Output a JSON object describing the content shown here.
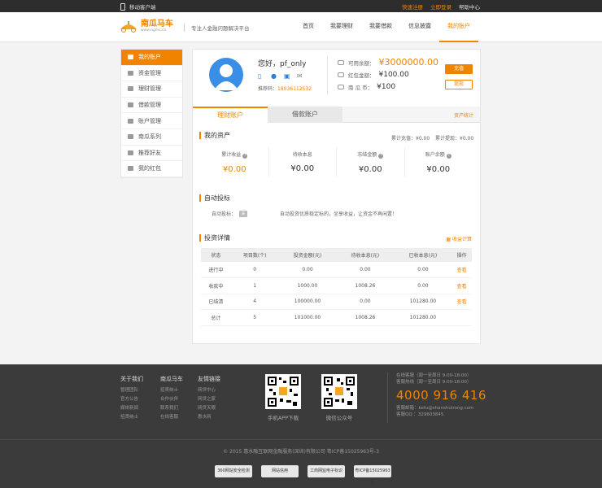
{
  "topbar": {
    "mobile_label": "移动客户端",
    "register": "快速注册",
    "login": "立即登录",
    "help": "帮助中心"
  },
  "header": {
    "logo_text": "南瓜马车",
    "logo_sub": "www.ngmc.cn",
    "slogan": "专注人金融问题解决平台",
    "nav": [
      "首页",
      "我要理财",
      "我要借款",
      "信息披露",
      "我的账户"
    ]
  },
  "sidebar": {
    "items": [
      "我的账户",
      "资金管理",
      "理财管理",
      "借款管理",
      "账户管理",
      "南瓜系列",
      "推荐好友",
      "我的红包"
    ]
  },
  "profile": {
    "greeting": "您好，pf_only",
    "phone_label": "推荐码：",
    "phone_value": "18036112532"
  },
  "balances": {
    "available_label": "可用余额：",
    "available_value": "¥3000000.00",
    "redpack_label": "红包金额：",
    "redpack_value": "¥100.00",
    "coin_label": "南 瓜 币：",
    "coin_value": "¥100"
  },
  "buttons": {
    "recharge": "充值",
    "withdraw": "提现"
  },
  "tabs": {
    "active": "理财账户",
    "other": "借款账户",
    "link": "资产统计"
  },
  "assets": {
    "title": "我的资产",
    "total_earn_label": "累计充值：¥0.00",
    "total_withdraw_label": "累计提现：¥0.00",
    "items": [
      {
        "label": "累计收益",
        "value": "¥0.00",
        "help": "?"
      },
      {
        "label": "待收本息",
        "value": "¥0.00"
      },
      {
        "label": "冻结金额",
        "value": "¥0.00",
        "help": "?"
      },
      {
        "label": "账户余额",
        "value": "¥0.00",
        "help": "?"
      }
    ]
  },
  "auto_bid": {
    "title": "自动投标",
    "status_label": "自动投标：",
    "status_value": "关",
    "desc": "自动投资优质稳定标的，坐享收益，让资金不再闲置！"
  },
  "invest": {
    "title": "投资详情",
    "calc_link": "收益计算",
    "columns": [
      "状态",
      "项目数(个)",
      "投资金额(元)",
      "待收本息(元)",
      "已收本息(元)",
      "操作"
    ],
    "rows": [
      [
        "进行中",
        "0",
        "0.00",
        "0.00",
        "0.00",
        "查看"
      ],
      [
        "收款中",
        "1",
        "1000.00",
        "1008.26",
        "0.00",
        "查看"
      ],
      [
        "已结清",
        "4",
        "100000.00",
        "0.00",
        "101280.00",
        "查看"
      ],
      [
        "总计",
        "5",
        "101000.00",
        "1008.26",
        "101280.00",
        ""
      ]
    ]
  },
  "footer": {
    "col1": {
      "head": "关于我们",
      "items": [
        "管理团队",
        "官方公告",
        "媒体新闻",
        "招贤纳士"
      ]
    },
    "col2": {
      "head": "南瓜马车",
      "items": [
        "招贤纳士",
        "合作伙伴",
        "联系我们",
        "在线客服"
      ]
    },
    "col3": {
      "head": "友情链接",
      "items": [
        "网贷中心",
        "网贷之家",
        "网贷天眼",
        "惠水网"
      ]
    },
    "qr1_label": "手机APP下载",
    "qr2_label": "微信公众号",
    "hours1": "在线客服（周一至周日 9:00-18:00）",
    "hours2": "客服热线（周一至周日 9:00-18:00）",
    "hotline": "4000 916 416",
    "email": "客服邮箱：kefu@shanshuirong.com",
    "qq": "客服QQ  ：329603845",
    "copyright": "© 2015  惠水融互联网金融服务(深圳)有限公司    粤ICP备15025963号-3",
    "badges": [
      "360网站安全检测",
      "网站信用",
      "工商网监电子标识",
      "粤ICP备15025963号"
    ]
  }
}
